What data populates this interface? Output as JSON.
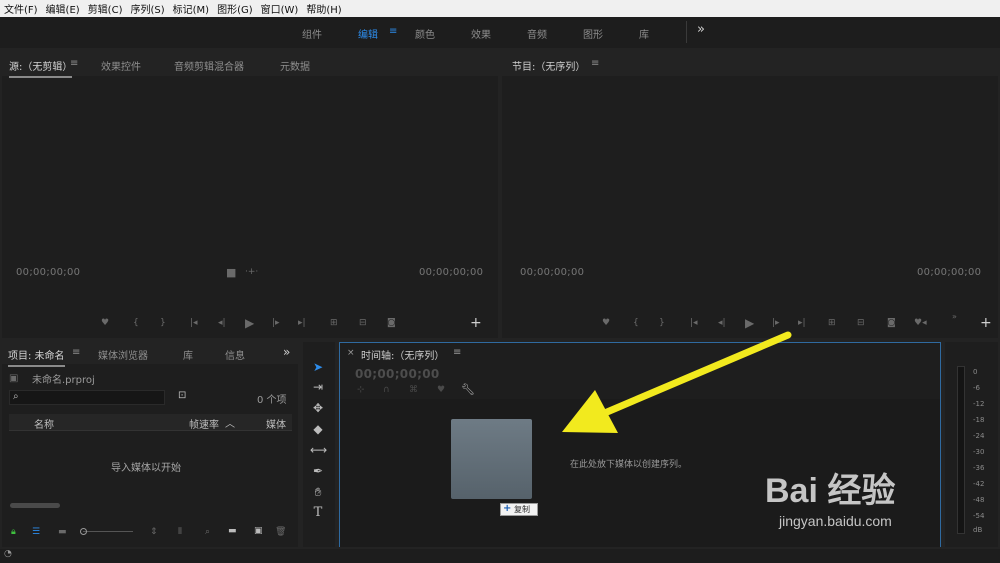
{
  "menu": [
    "文件(F)",
    "编辑(E)",
    "剪辑(C)",
    "序列(S)",
    "标记(M)",
    "图形(G)",
    "窗口(W)",
    "帮助(H)"
  ],
  "workspaces": {
    "items": [
      "组件",
      "编辑",
      "颜色",
      "效果",
      "音频",
      "图形",
      "库"
    ],
    "active": "编辑",
    "more": "»"
  },
  "source_panel": {
    "tabs": [
      "源:（无剪辑）",
      "效果控件",
      "音频剪辑混合器",
      "元数据"
    ],
    "tc_left": "00;00;00;00",
    "tc_right": "00;00;00;00"
  },
  "program_panel": {
    "tab": "节目:（无序列）",
    "tc_left": "00;00;00;00",
    "tc_right": "00;00;00;00"
  },
  "project_panel": {
    "tabs": [
      "项目: 未命名",
      "媒体浏览器",
      "库",
      "信息"
    ],
    "project_file": "未命名.prproj",
    "item_count": "0 个项",
    "columns": [
      "名称",
      "帧速率",
      "媒体"
    ],
    "empty_hint": "导入媒体以开始"
  },
  "timeline": {
    "title": "时间轴:（无序列）",
    "timecode": "00;00;00;00",
    "drop_hint": "在此处放下媒体以创建序列。",
    "drag_badge": "复制"
  },
  "meter": {
    "ticks": [
      "0",
      "-6",
      "-12",
      "-18",
      "-24",
      "-30",
      "-36",
      "-42",
      "-48",
      "-54",
      "dB"
    ]
  },
  "watermark": {
    "logo": "Bai 经验",
    "url": "jingyan.baidu.com"
  },
  "colors": {
    "accent": "#2d8ceb",
    "arrow": "#f2ea1e",
    "panel": "#1e1e1e"
  }
}
